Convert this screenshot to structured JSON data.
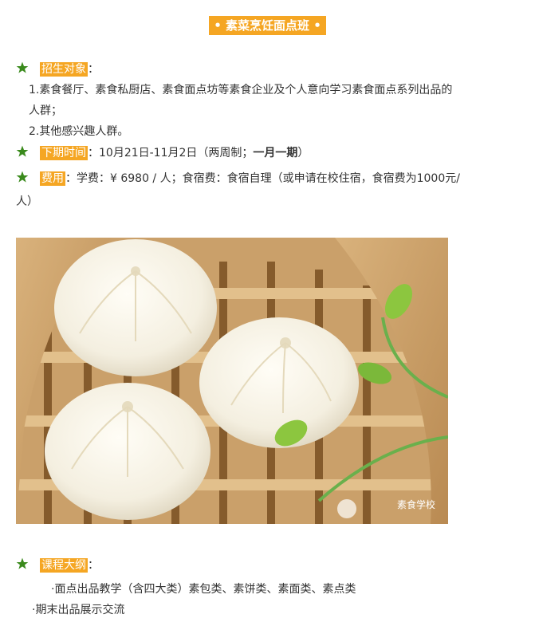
{
  "title": "• 素菜烹饪面点班 •",
  "enrollment": {
    "label": "招生对象",
    "colon": "：",
    "items": [
      "1.素食餐厅、素食私厨店、素食面点坊等素食企业及个人意向学习素食面点系列出品的",
      "人群；",
      "2.其他感兴趣人群。"
    ]
  },
  "schedule": {
    "label": "下期时间",
    "colon": "：",
    "text": "10月21日-11月2日（两周制；",
    "bold": "一月一期",
    "close": "）"
  },
  "fee": {
    "label": "费用",
    "colon": "：",
    "text": "学费：¥ 6980 / 人；食宿费：食宿自理（或申请在校住宿，食宿费为1000元/",
    "cont": "人）"
  },
  "image": {
    "alt": "素食包子蒸笼",
    "watermark": "素食学校"
  },
  "syllabus": {
    "label": "课程大纲",
    "colon": "：",
    "items": [
      "·面点出品教学（含四大类）素包类、素饼类、素面类、素点类",
      "·期末出品展示交流"
    ]
  },
  "colors": {
    "accent": "#f5a623",
    "star": "#3a8a1c"
  }
}
